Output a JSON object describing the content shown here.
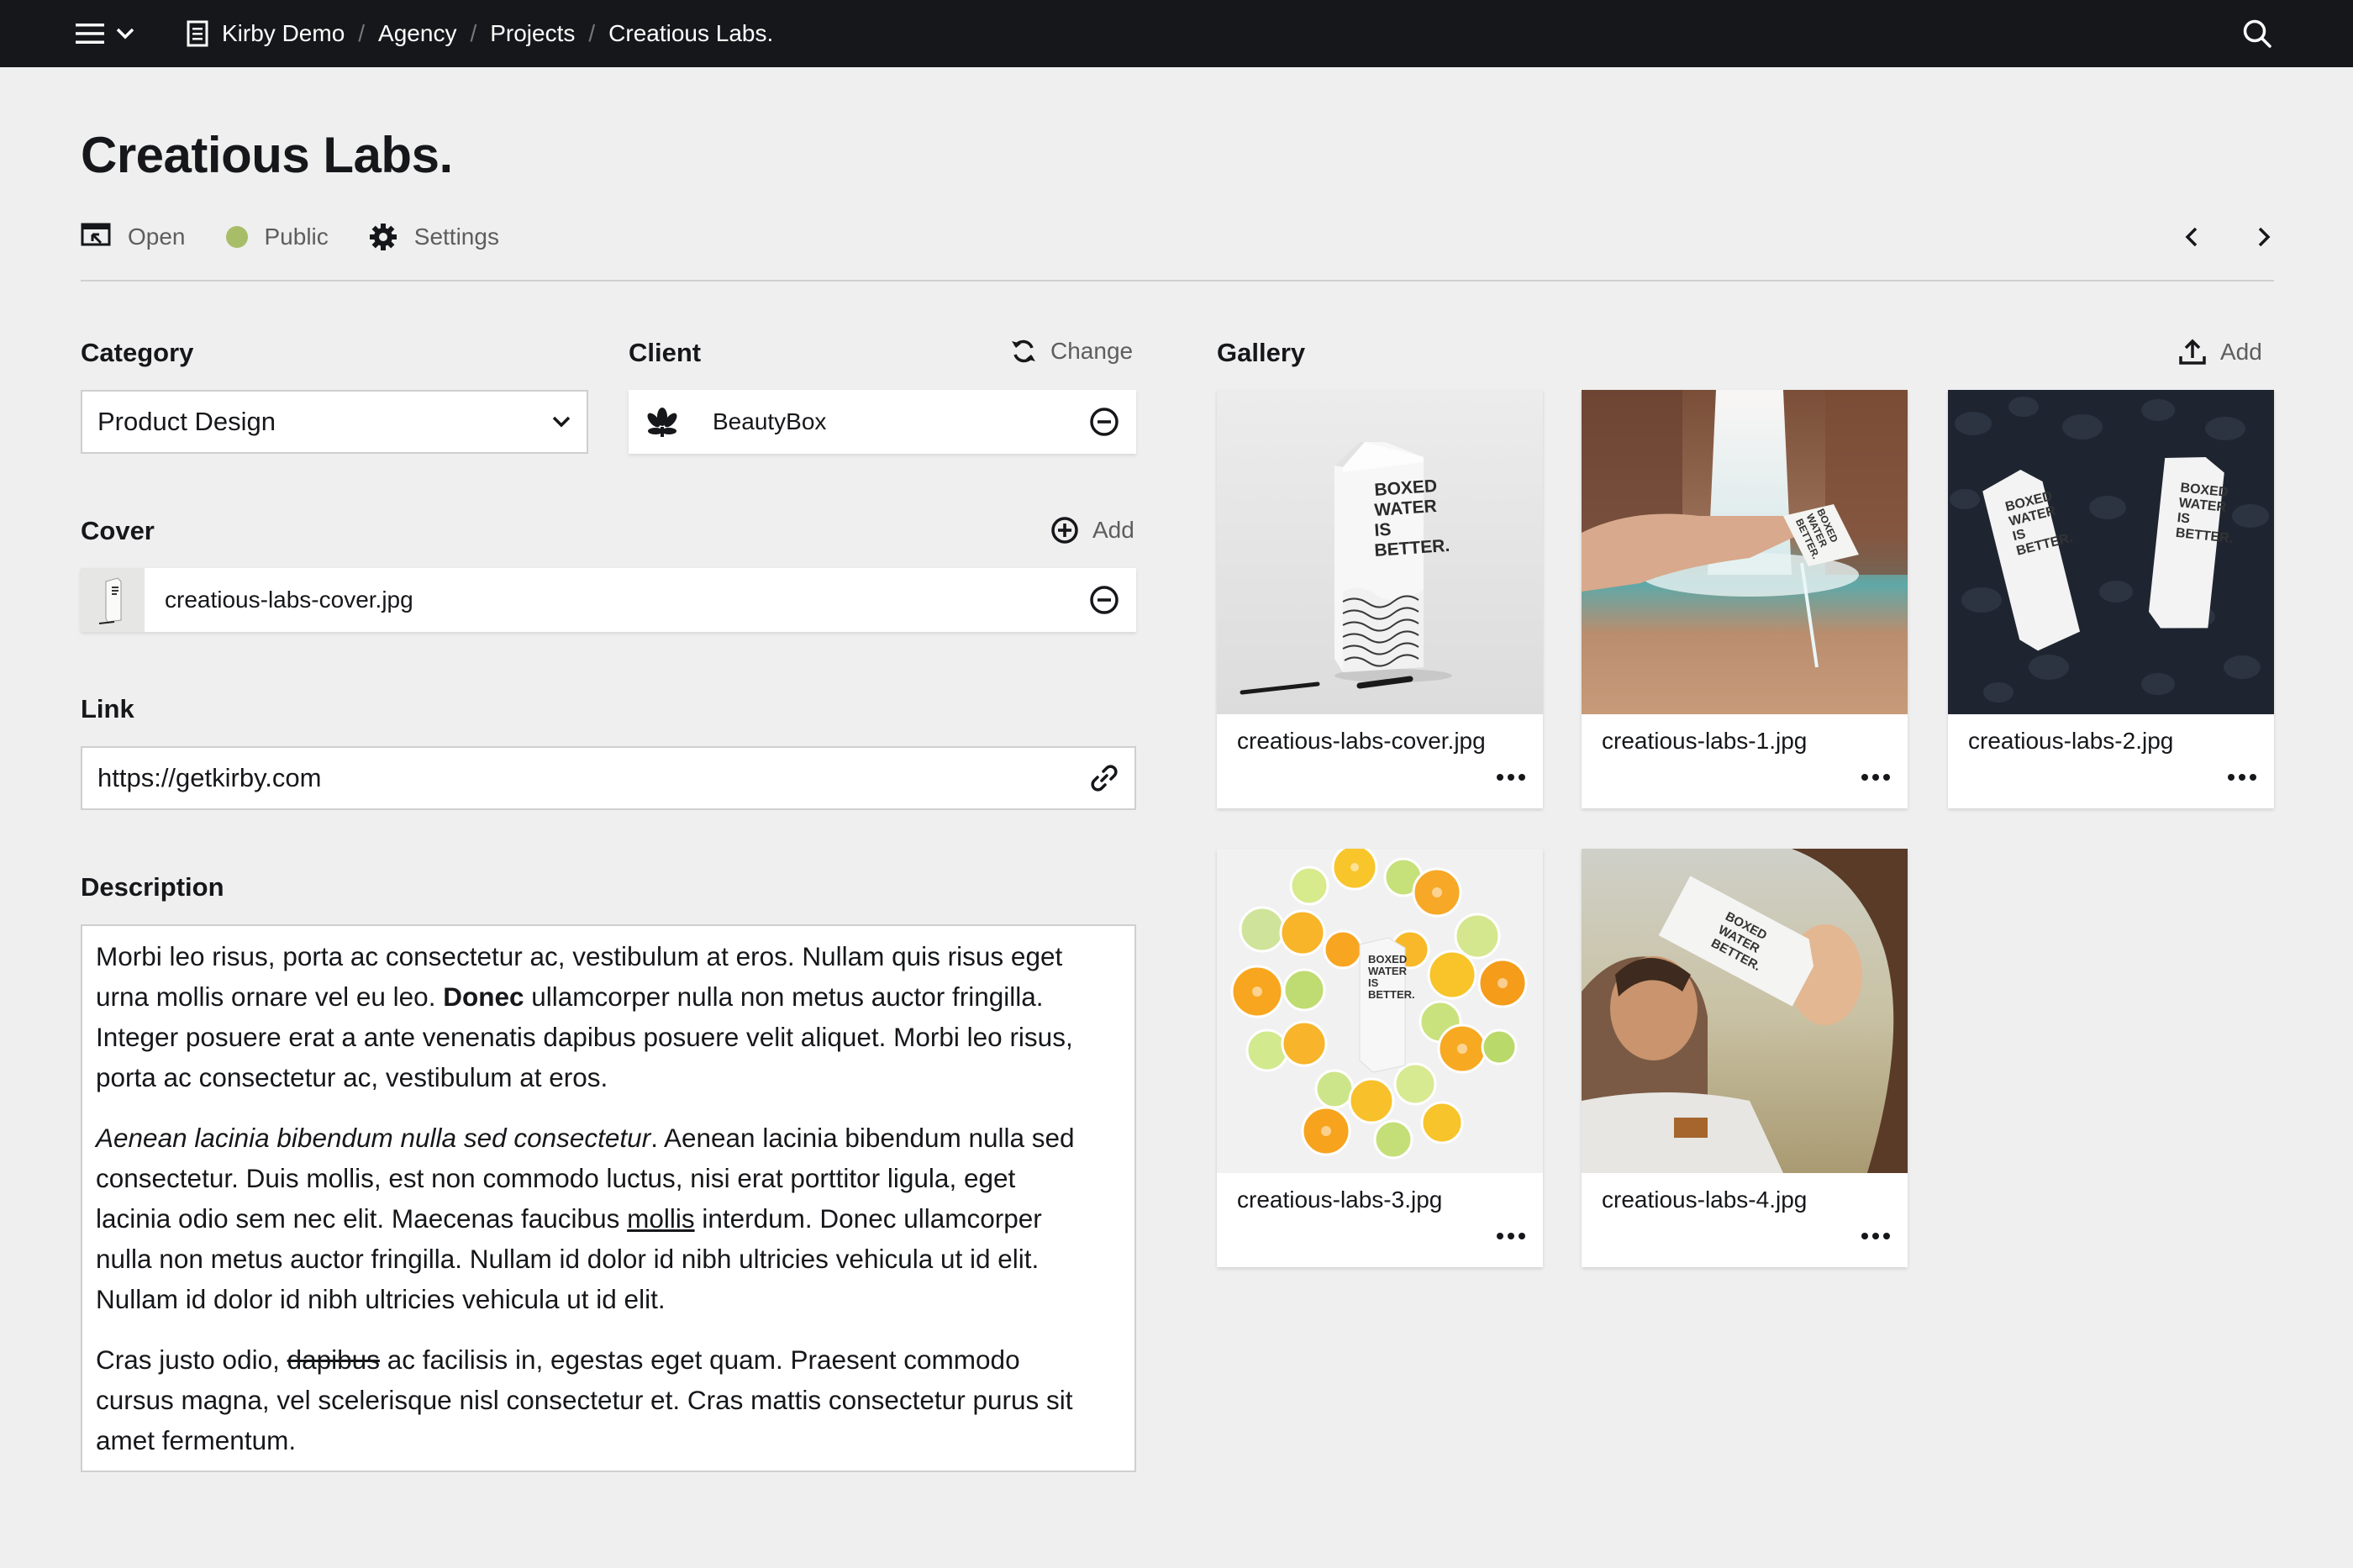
{
  "topbar": {
    "breadcrumbs": [
      "Kirby Demo",
      "Agency",
      "Projects",
      "Creatious Labs."
    ]
  },
  "page": {
    "title": "Creatious Labs.",
    "options": {
      "open": "Open",
      "status": "Public",
      "settings": "Settings"
    },
    "colors": {
      "status_public": "#a7bd68",
      "topbar": "#16171a",
      "background": "#efefef"
    }
  },
  "fields": {
    "category": {
      "label": "Category",
      "value": "Product Design"
    },
    "client": {
      "label": "Client",
      "action": "Change",
      "item": "BeautyBox"
    },
    "cover": {
      "label": "Cover",
      "action": "Add",
      "item": "creatious-labs-cover.jpg"
    },
    "link": {
      "label": "Link",
      "value": "https://getkirby.com"
    },
    "description": {
      "label": "Description",
      "p1": [
        "Morbi leo risus, porta ac consectetur ac, vestibulum at eros. Nullam quis risus eget",
        "urna mollis ornare vel eu leo. ",
        "Donec",
        " ullamcorper nulla non metus auctor fringilla.",
        "Integer posuere erat a ante venenatis dapibus posuere velit aliquet. Morbi leo risus,",
        "porta ac consectetur ac, vestibulum at eros."
      ],
      "p2": [
        "Aenean lacinia bibendum nulla sed consectetur",
        ". Aenean lacinia bibendum nulla sed",
        "consectetur. Duis mollis, est non commodo luctus, nisi erat porttitor ligula, eget",
        "lacinia odio sem nec elit. Maecenas faucibus ",
        "mollis",
        " interdum. Donec ullamcorper",
        "nulla non metus auctor fringilla. Nullam id dolor id nibh ultricies vehicula ut id elit.",
        "Nullam id dolor id nibh ultricies vehicula ut id elit."
      ],
      "p3": [
        "Cras justo odio, ",
        "dapibus",
        " ac facilisis in, egestas eget quam. Praesent commodo",
        "cursus magna, vel scelerisque nisl consectetur et. Cras mattis consectetur purus sit",
        "amet fermentum."
      ]
    }
  },
  "gallery": {
    "label": "Gallery",
    "action": "Add",
    "files": [
      "creatious-labs-cover.jpg",
      "creatious-labs-1.jpg",
      "creatious-labs-2.jpg",
      "creatious-labs-3.jpg",
      "creatious-labs-4.jpg"
    ],
    "carton_text": {
      "line1": "BOXED",
      "line2": "WATER",
      "line3": "IS",
      "line4": "BETTER."
    }
  }
}
